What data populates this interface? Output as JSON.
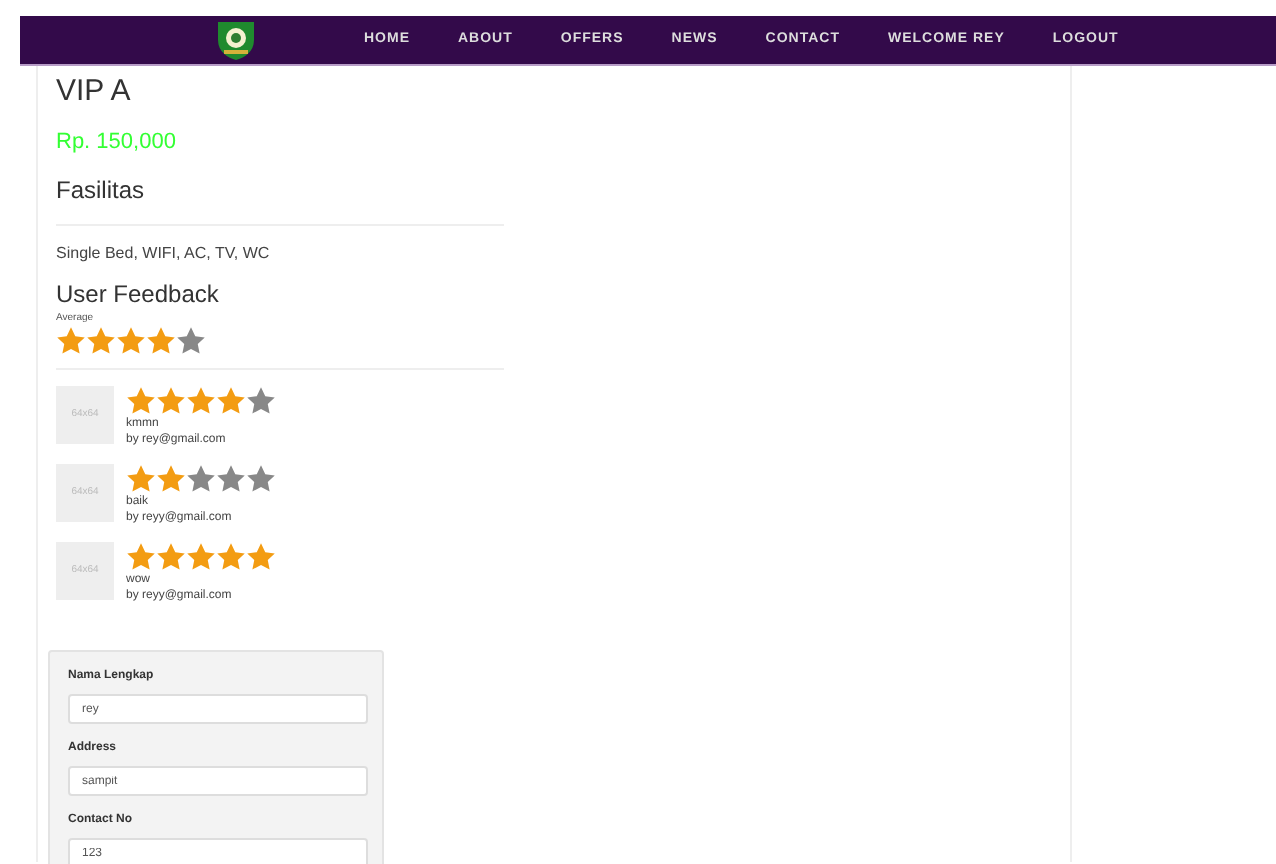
{
  "nav": {
    "items": [
      "HOME",
      "ABOUT",
      "OFFERS",
      "NEWS",
      "CONTACT",
      "WELCOME REY",
      "LOGOUT"
    ]
  },
  "room": {
    "title": "VIP A",
    "price": "Rp. 150,000",
    "facilities_heading": "Fasilitas",
    "facilities": "Single Bed, WIFI, AC, TV, WC"
  },
  "feedback": {
    "heading": "User Feedback",
    "average": {
      "label": "Average",
      "stars": 4
    },
    "reviews": [
      {
        "avatar": "64x64",
        "stars": 4,
        "comment": "kmmn",
        "author": "by rey@gmail.com"
      },
      {
        "avatar": "64x64",
        "stars": 2,
        "comment": "baik",
        "author": "by reyy@gmail.com"
      },
      {
        "avatar": "64x64",
        "stars": 5,
        "comment": "wow",
        "author": "by reyy@gmail.com"
      }
    ]
  },
  "form": {
    "fields": [
      {
        "label": "Nama Lengkap",
        "value": "rey"
      },
      {
        "label": "Address",
        "value": "sampit"
      },
      {
        "label": "Contact No",
        "value": "123"
      }
    ]
  }
}
